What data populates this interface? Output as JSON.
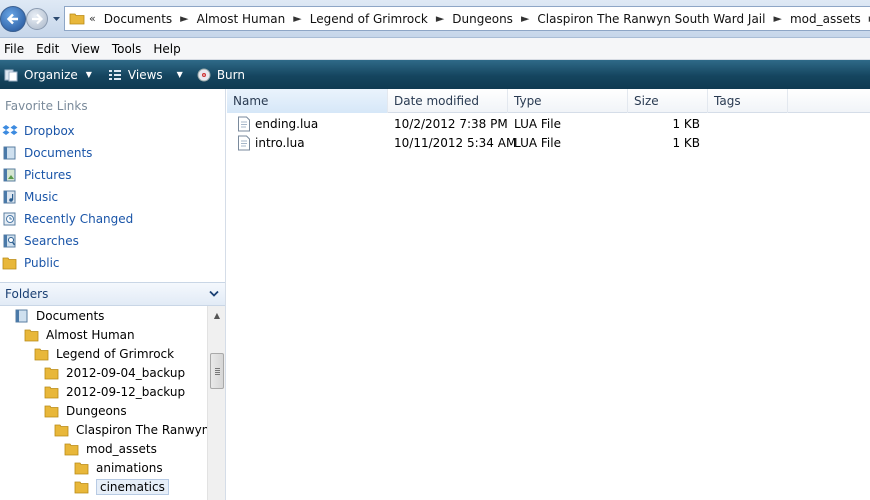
{
  "address_bar": {
    "overflow_glyph": "«",
    "breadcrumbs": [
      "Documents",
      "Almost Human",
      "Legend of Grimrock",
      "Dungeons",
      "Claspiron  The Ranwyn South Ward Jail",
      "mod_assets",
      "cinematics"
    ]
  },
  "menu": [
    "File",
    "Edit",
    "View",
    "Tools",
    "Help"
  ],
  "toolbar": {
    "organize": "Organize",
    "views": "Views",
    "burn": "Burn"
  },
  "favorites": {
    "title": "Favorite Links",
    "items": [
      {
        "label": "Dropbox",
        "icon": "dropbox-icon"
      },
      {
        "label": "Documents",
        "icon": "documents-icon"
      },
      {
        "label": "Pictures",
        "icon": "pictures-icon"
      },
      {
        "label": "Music",
        "icon": "music-icon"
      },
      {
        "label": "Recently Changed",
        "icon": "recently-changed-icon"
      },
      {
        "label": "Searches",
        "icon": "searches-icon"
      },
      {
        "label": "Public",
        "icon": "public-folder-icon"
      }
    ]
  },
  "folders": {
    "title": "Folders",
    "tree": [
      {
        "label": "Documents",
        "level": 0,
        "icon": "documents-icon"
      },
      {
        "label": "Almost Human",
        "level": 1,
        "icon": "folder-icon"
      },
      {
        "label": "Legend of Grimrock",
        "level": 2,
        "icon": "folder-icon"
      },
      {
        "label": "2012-09-04_backup",
        "level": 3,
        "icon": "folder-icon"
      },
      {
        "label": "2012-09-12_backup",
        "level": 3,
        "icon": "folder-icon"
      },
      {
        "label": "Dungeons",
        "level": 3,
        "icon": "folder-icon"
      },
      {
        "label": "Claspiron  The Ranwyn S",
        "level": 4,
        "icon": "folder-icon"
      },
      {
        "label": "mod_assets",
        "level": 5,
        "icon": "folder-icon"
      },
      {
        "label": "animations",
        "level": 6,
        "icon": "folder-icon"
      },
      {
        "label": "cinematics",
        "level": 6,
        "icon": "folder-icon",
        "selected": true
      }
    ]
  },
  "columns": [
    "Name",
    "Date modified",
    "Type",
    "Size",
    "Tags"
  ],
  "files": [
    {
      "name": "ending.lua",
      "date": "10/2/2012 7:38 PM",
      "type": "LUA File",
      "size": "1 KB",
      "tags": ""
    },
    {
      "name": "intro.lua",
      "date": "10/11/2012 5:34 AM",
      "type": "LUA File",
      "size": "1 KB",
      "tags": ""
    }
  ],
  "colors": {
    "toolbar": "#15455f",
    "link": "#1a55a8",
    "folder": "#e8b73a"
  }
}
